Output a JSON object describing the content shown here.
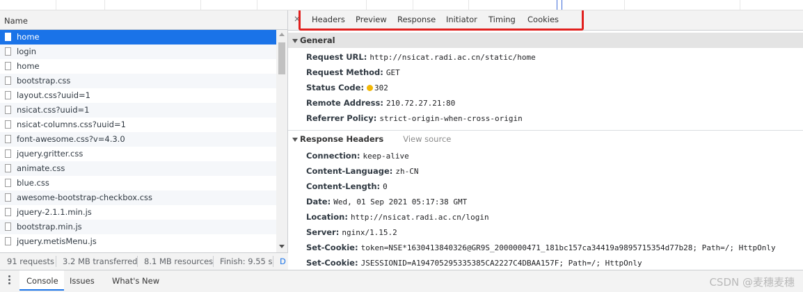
{
  "left_panel": {
    "column_header": "Name",
    "requests": [
      {
        "name": "home",
        "selected": true
      },
      {
        "name": "login"
      },
      {
        "name": "home"
      },
      {
        "name": "bootstrap.css"
      },
      {
        "name": "layout.css?uuid=1"
      },
      {
        "name": "nsicat.css?uuid=1"
      },
      {
        "name": "nsicat-columns.css?uuid=1"
      },
      {
        "name": "font-awesome.css?v=4.3.0"
      },
      {
        "name": "jquery.gritter.css"
      },
      {
        "name": "animate.css"
      },
      {
        "name": "blue.css"
      },
      {
        "name": "awesome-bootstrap-checkbox.css"
      },
      {
        "name": "jquery-2.1.1.min.js"
      },
      {
        "name": "bootstrap.min.js"
      },
      {
        "name": "jquery.metisMenu.js"
      }
    ]
  },
  "status_bar": {
    "requests": "91 requests",
    "transferred": "3.2 MB transferred",
    "resources": "8.1 MB resources",
    "finish": "Finish: 9.55 s",
    "more": "D"
  },
  "detail_tabs": [
    "Headers",
    "Preview",
    "Response",
    "Initiator",
    "Timing",
    "Cookies"
  ],
  "close_glyph": "×",
  "general": {
    "title": "General",
    "rows": [
      {
        "key": "Request URL:",
        "value": "http://nsicat.radi.ac.cn/static/home"
      },
      {
        "key": "Request Method:",
        "value": "GET"
      },
      {
        "key": "Status Code:",
        "value": "302"
      },
      {
        "key": "Remote Address:",
        "value": "210.72.27.21:80"
      },
      {
        "key": "Referrer Policy:",
        "value": "strict-origin-when-cross-origin"
      }
    ]
  },
  "response_headers": {
    "title": "Response Headers",
    "view_source": "View source",
    "rows": [
      {
        "key": "Connection:",
        "value": "keep-alive"
      },
      {
        "key": "Content-Language:",
        "value": "zh-CN"
      },
      {
        "key": "Content-Length:",
        "value": "0"
      },
      {
        "key": "Date:",
        "value": "Wed, 01 Sep 2021 05:17:38 GMT"
      },
      {
        "key": "Location:",
        "value": "http://nsicat.radi.ac.cn/login"
      },
      {
        "key": "Server:",
        "value": "nginx/1.15.2"
      },
      {
        "key": "Set-Cookie:",
        "value": "token=NSE*1630413840326@GR9S_2000000471_181bc157ca34419a9895715354d77b28; Path=/; HttpOnly"
      },
      {
        "key": "Set-Cookie:",
        "value": "JSESSIONID=A194705295335385CA2227C4DBAA157F; Path=/; HttpOnly"
      }
    ]
  },
  "drawer": {
    "tabs": [
      "Console",
      "Issues",
      "What's New"
    ],
    "watermark": "CSDN @麦穗麦穗"
  },
  "colors": {
    "selected_row": "#1a73e8",
    "highlight_box": "#e1201e",
    "status_dot": "#f2b705"
  }
}
